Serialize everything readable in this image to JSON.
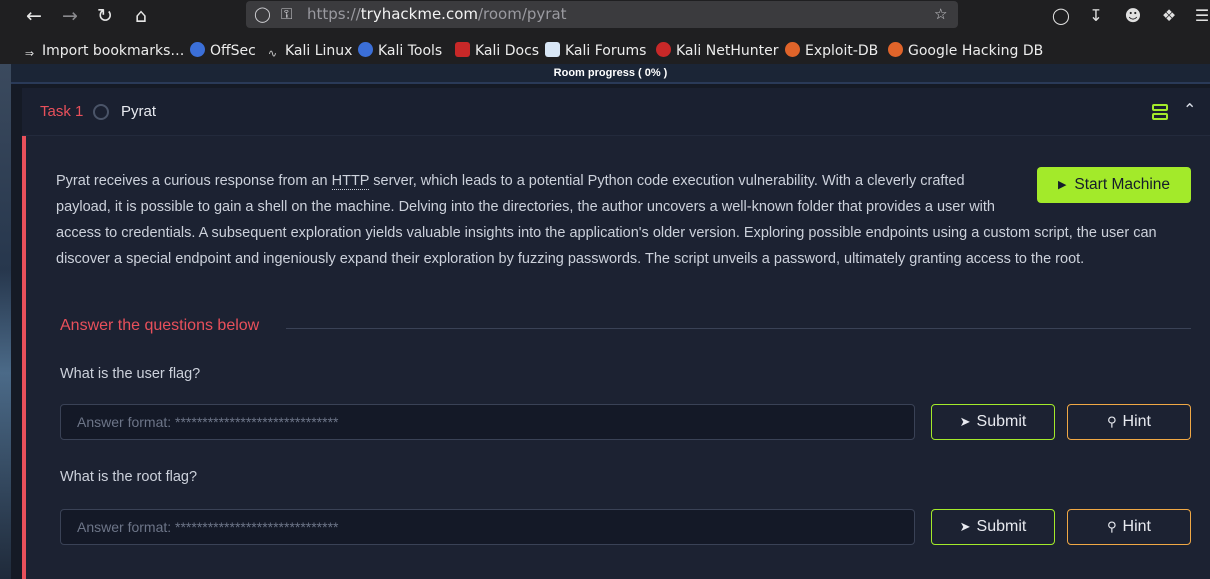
{
  "browser": {
    "url_prefix": "https://",
    "url_host": "tryhackme.com",
    "url_path": "/room/pyrat",
    "icons": [
      "back-icon",
      "forward-icon",
      "reload-icon",
      "home-icon",
      "shield-icon",
      "lock-icon",
      "star-icon",
      "pocket-icon",
      "download-icon",
      "account-icon",
      "extensions-icon",
      "menu-icon"
    ],
    "bookmarks": [
      {
        "label": "Import bookmarks…",
        "icon": "import-icon"
      },
      {
        "label": "OffSec",
        "icon": "offsec-icon"
      },
      {
        "label": "Kali Linux",
        "icon": "kali-icon"
      },
      {
        "label": "Kali Tools",
        "icon": "kali-tools-icon"
      },
      {
        "label": "Kali Docs",
        "icon": "kali-docs-icon"
      },
      {
        "label": "Kali Forums",
        "icon": "kali-forums-icon"
      },
      {
        "label": "Kali NetHunter",
        "icon": "nethunter-icon"
      },
      {
        "label": "Exploit-DB",
        "icon": "exploit-db-icon"
      },
      {
        "label": "Google Hacking DB",
        "icon": "ghdb-icon"
      }
    ]
  },
  "room": {
    "progress_label": "Room progress ( 0% )"
  },
  "task": {
    "label": "Task 1",
    "title": "Pyrat",
    "start_machine_label": "Start Machine",
    "description_pre": "Pyrat receives a curious response from an ",
    "description_abbr": "HTTP",
    "description_post": " server, which leads to a potential Python code execution vulnerability. With a cleverly crafted payload, it is possible to gain a shell on the machine. Delving into the directories, the author uncovers a well-known folder that provides a user with access to credentials. A subsequent exploration yields valuable insights into the application's older version. Exploring possible endpoints using a custom script, the user can discover a special endpoint and ingeniously expand their exploration by fuzzing passwords. The script unveils a password, ultimately granting access to the root.",
    "answer_heading": "Answer the questions below",
    "questions": [
      {
        "text": "What is the user flag?",
        "placeholder": "Answer format: ******************************",
        "submit": "Submit",
        "hint": "Hint"
      },
      {
        "text": "What is the root flag?",
        "placeholder": "Answer format: ******************************",
        "submit": "Submit",
        "hint": "Hint"
      }
    ]
  },
  "colors": {
    "accent_green": "#a3ea2a",
    "accent_red": "#e8505b",
    "hint_orange": "#f0a845"
  }
}
